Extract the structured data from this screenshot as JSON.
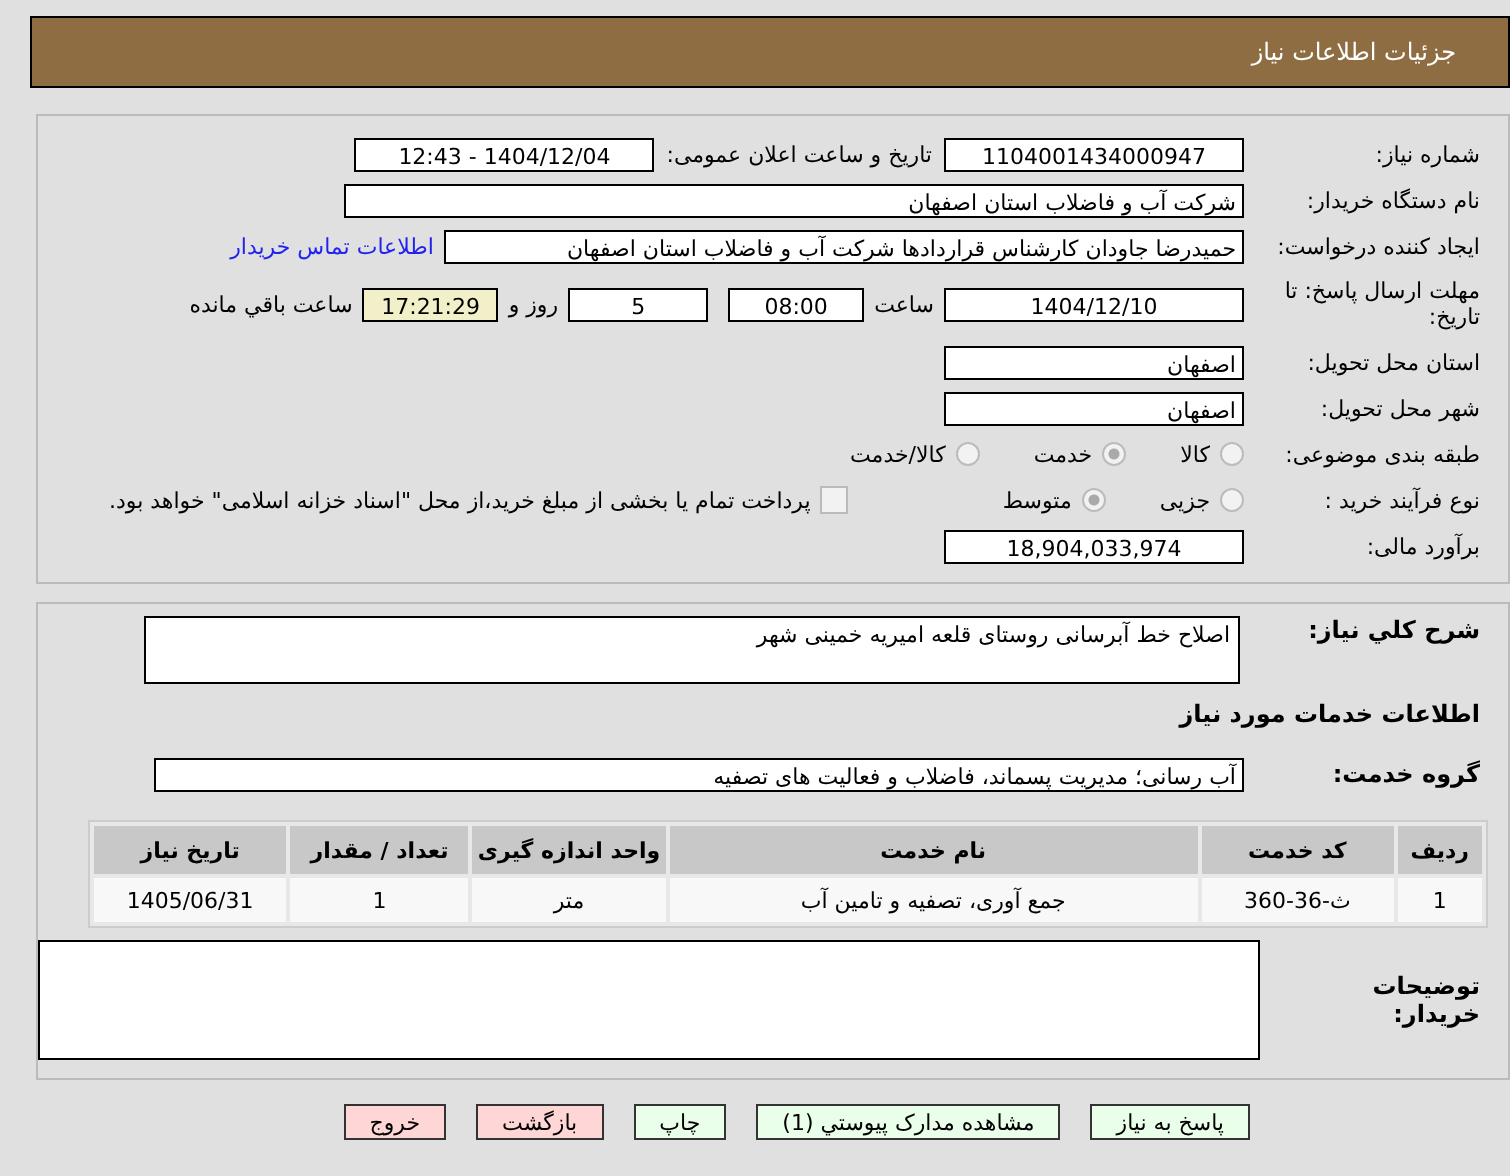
{
  "header": {
    "title": "جزئیات اطلاعات نیاز"
  },
  "details": {
    "need_number": {
      "label": "شماره نیاز:",
      "value": "1104001434000947"
    },
    "announce": {
      "label": "تاریخ و ساعت اعلان عمومی:",
      "value": "1404/12/04 - 12:43"
    },
    "buyer": {
      "label": "نام دستگاه خریدار:",
      "value": "شرکت آب و فاضلاب استان اصفهان"
    },
    "creator": {
      "label": "ایجاد کننده درخواست:",
      "value": "حمیدرضا جاودان کارشناس قراردادها شرکت آب و فاضلاب استان اصفهان",
      "link": "اطلاعات تماس خریدار"
    },
    "deadline": {
      "label": "مهلت ارسال پاسخ: تا تاریخ:",
      "date": "1404/12/10",
      "time_label": "ساعت",
      "time": "08:00",
      "days": "5",
      "days_label": "روز و",
      "remaining": "17:21:29",
      "remaining_label": "ساعت باقي مانده"
    },
    "province": {
      "label": "استان محل تحویل:",
      "value": "اصفهان"
    },
    "city": {
      "label": "شهر محل تحویل:",
      "value": "اصفهان"
    },
    "category": {
      "label": "طبقه بندی موضوعی:",
      "options": [
        {
          "label": "کالا",
          "selected": false
        },
        {
          "label": "خدمت",
          "selected": true
        },
        {
          "label": "کالا/خدمت",
          "selected": false
        }
      ]
    },
    "process": {
      "label": "نوع فرآیند خرید :",
      "options": [
        {
          "label": "جزیی",
          "selected": false
        },
        {
          "label": "متوسط",
          "selected": true
        }
      ],
      "treasury": {
        "checked": false,
        "text": "پرداخت تمام یا بخشی از مبلغ خرید،از محل \"اسناد خزانه اسلامی\" خواهد بود."
      }
    },
    "estimate": {
      "label": "برآورد مالی:",
      "value": "18,904,033,974"
    }
  },
  "services": {
    "description": {
      "label": "شرح کلي نیاز:",
      "value": "اصلاح خط آبرسانی روستای قلعه امیریه خمینی شهر"
    },
    "heading": "اطلاعات خدمات مورد نیاز",
    "group": {
      "label": "گروه خدمت:",
      "value": "آب رسانی؛ مدیریت پسماند، فاضلاب و فعالیت های تصفیه"
    },
    "table": {
      "columns": [
        "ردیف",
        "کد خدمت",
        "نام خدمت",
        "واحد اندازه گیری",
        "تعداد / مقدار",
        "تاریخ نیاز"
      ],
      "rows": [
        [
          "1",
          "ث-36-360",
          "جمع آوری، تصفیه و تامین آب",
          "متر",
          "1",
          "1405/06/31"
        ]
      ]
    },
    "notes": {
      "label": "توضیحات خریدار:"
    }
  },
  "buttons": [
    {
      "label": "پاسخ به نیاز",
      "kind": "primary"
    },
    {
      "label": "مشاهده مدارک پیوستي (1)",
      "kind": "primary"
    },
    {
      "label": "چاپ",
      "kind": "primary"
    },
    {
      "label": "بازگشت",
      "kind": "danger"
    },
    {
      "label": "خروج",
      "kind": "danger"
    }
  ]
}
